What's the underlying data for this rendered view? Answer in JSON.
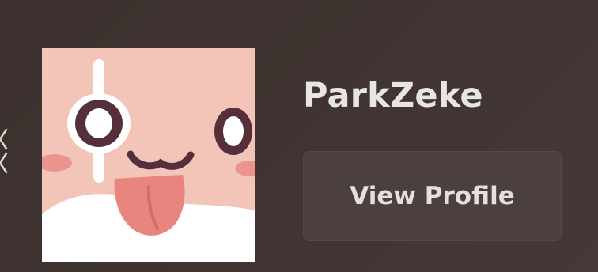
{
  "profile": {
    "username": "ParkZeke",
    "view_profile_label": "View Profile",
    "avatar_icon": "tongue-face-avatar"
  },
  "edge_icon": "chevron-left-icon",
  "colors": {
    "background": "#3f3431",
    "button_background": "#4b403d",
    "text": "#e7e5e5",
    "avatar_background": "#f3c5b8"
  }
}
